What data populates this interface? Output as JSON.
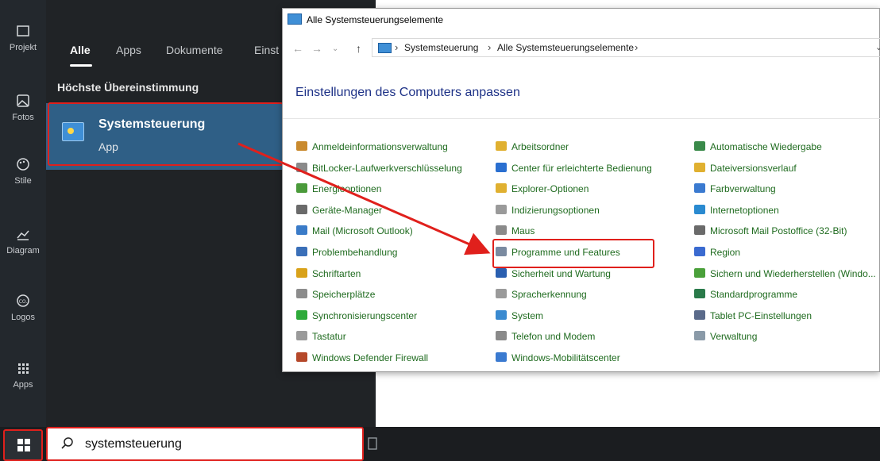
{
  "rail": {
    "items": [
      {
        "label": "Projekt",
        "icon": "folder-icon"
      },
      {
        "label": "Fotos",
        "icon": "image-icon"
      },
      {
        "label": "Stile",
        "icon": "palette-icon"
      },
      {
        "label": "Diagram",
        "icon": "chart-icon"
      },
      {
        "label": "Logos",
        "icon": "logo-icon"
      },
      {
        "label": "Apps",
        "icon": "apps-grid-icon"
      }
    ]
  },
  "search_panel": {
    "tabs": [
      "Alle",
      "Apps",
      "Dokumente",
      "Einst"
    ],
    "best_match_label": "Höchste Übereinstimmung",
    "result": {
      "title": "Systemsteuerung",
      "subtitle": "App"
    }
  },
  "taskbar": {
    "search_value": "systemsteuerung"
  },
  "control_panel": {
    "window_title": "Alle Systemsteuerungselemente",
    "breadcrumb": [
      "Systemsteuerung",
      "Alle Systemsteuerungselemente"
    ],
    "heading": "Einstellungen des Computers anpassen",
    "columns": [
      [
        {
          "label": "Anmeldeinformationsverwaltung",
          "color": "#c98a2e"
        },
        {
          "label": "BitLocker-Laufwerkverschlüsselung",
          "color": "#8a8a8a"
        },
        {
          "label": "Energieoptionen",
          "color": "#4a9a3a"
        },
        {
          "label": "Geräte-Manager",
          "color": "#6a6a6a"
        },
        {
          "label": "Mail (Microsoft Outlook)",
          "color": "#3a7bc8"
        },
        {
          "label": "Problembehandlung",
          "color": "#3a6fb8"
        },
        {
          "label": "Schriftarten",
          "color": "#d9a21a"
        },
        {
          "label": "Speicherplätze",
          "color": "#8c8c8c"
        },
        {
          "label": "Synchronisierungscenter",
          "color": "#2eaa3a"
        },
        {
          "label": "Tastatur",
          "color": "#9a9a9a"
        },
        {
          "label": "Windows Defender Firewall",
          "color": "#b5482a"
        }
      ],
      [
        {
          "label": "Arbeitsordner",
          "color": "#e0b030"
        },
        {
          "label": "Center für erleichterte Bedienung",
          "color": "#2a6fd0"
        },
        {
          "label": "Explorer-Optionen",
          "color": "#e0b030"
        },
        {
          "label": "Indizierungsoptionen",
          "color": "#9a9a9a"
        },
        {
          "label": "Maus",
          "color": "#8a8a8a"
        },
        {
          "label": "Programme und Features",
          "color": "#7a8aa0"
        },
        {
          "label": "Sicherheit und Wartung",
          "color": "#2a5fb0"
        },
        {
          "label": "Spracherkennung",
          "color": "#9a9a9a"
        },
        {
          "label": "System",
          "color": "#3a8ad0"
        },
        {
          "label": "Telefon und Modem",
          "color": "#8a8a8a"
        },
        {
          "label": "Windows-Mobilitätscenter",
          "color": "#3a7ad0"
        }
      ],
      [
        {
          "label": "Automatische Wiedergabe",
          "color": "#3a8a4a"
        },
        {
          "label": "Dateiversionsverlauf",
          "color": "#e0b030"
        },
        {
          "label": "Farbverwaltung",
          "color": "#3a7ad0"
        },
        {
          "label": "Internetoptionen",
          "color": "#2a8ad0"
        },
        {
          "label": "Microsoft Mail Postoffice (32-Bit)",
          "color": "#6a6a6a"
        },
        {
          "label": "Region",
          "color": "#3a6ad0"
        },
        {
          "label": "Sichern und Wiederherstellen (Windo...",
          "color": "#4aa03a"
        },
        {
          "label": "Standardprogramme",
          "color": "#2a7a4a"
        },
        {
          "label": "Tablet PC-Einstellungen",
          "color": "#5a6a8a"
        },
        {
          "label": "Verwaltung",
          "color": "#8a9aa8"
        }
      ]
    ]
  },
  "accent": {
    "highlight": "#e0201c",
    "selection": "#2f5f86",
    "link": "#1e3287"
  }
}
